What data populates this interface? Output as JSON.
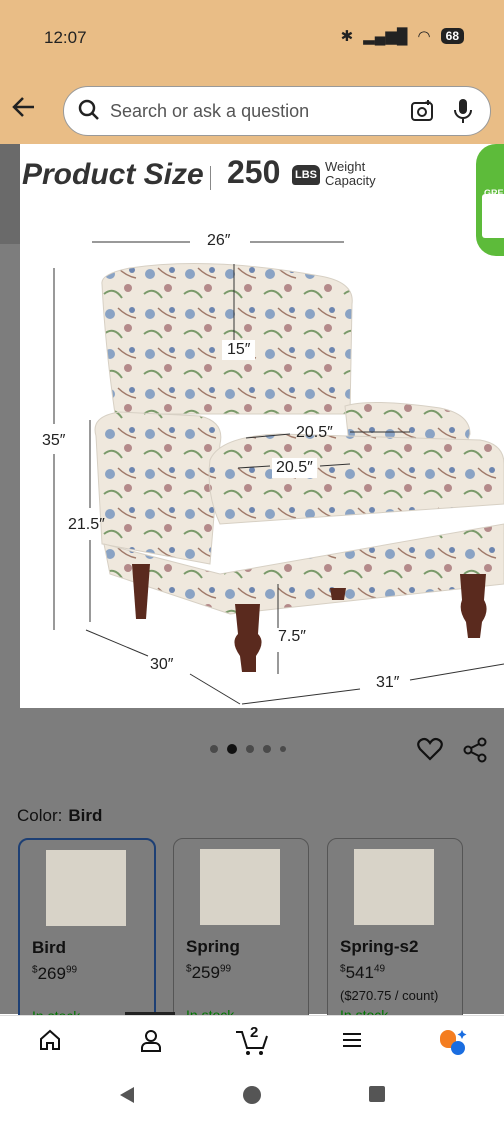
{
  "status": {
    "time": "12:07",
    "battery": "68"
  },
  "search": {
    "placeholder": "Search or ask a question"
  },
  "product_image": {
    "title": "Product Size",
    "weight_value": "250",
    "weight_unit": "LBS",
    "weight_label_line1": "Weight",
    "weight_label_line2": "Capacity",
    "badge_text": "GRE",
    "dimensions": {
      "width": "26″",
      "back_height": "15″",
      "height": "35″",
      "arm_height": "21.5″",
      "seat_depth": "20.5″",
      "seat_width": "20.5″",
      "leg_height": "7.5″",
      "depth": "30″",
      "overall_width": "31″"
    }
  },
  "carousel": {
    "total": 5,
    "active": 1
  },
  "color": {
    "label": "Color:",
    "selected": "Bird"
  },
  "variants": [
    {
      "name": "Bird",
      "price_whole": "269",
      "price_cents": "99",
      "stock": "In stock",
      "selected": true
    },
    {
      "name": "Spring",
      "price_whole": "259",
      "price_cents": "99",
      "stock": "In stock",
      "selected": false
    },
    {
      "name": "Spring-s2",
      "price_whole": "541",
      "price_cents": "49",
      "per_unit": "($270.75 / count)",
      "stock": "In stock",
      "selected": false
    }
  ],
  "currency_symbol": "$",
  "nav": [
    "home-icon",
    "account-icon",
    "cart-icon",
    "menu-icon",
    "rufus-icon"
  ],
  "cart_count": "2",
  "colors": {
    "header": "#e9bd86",
    "overlay": "#7d7d7d",
    "selected_border": "#1d3f74",
    "stock": "#007600"
  }
}
